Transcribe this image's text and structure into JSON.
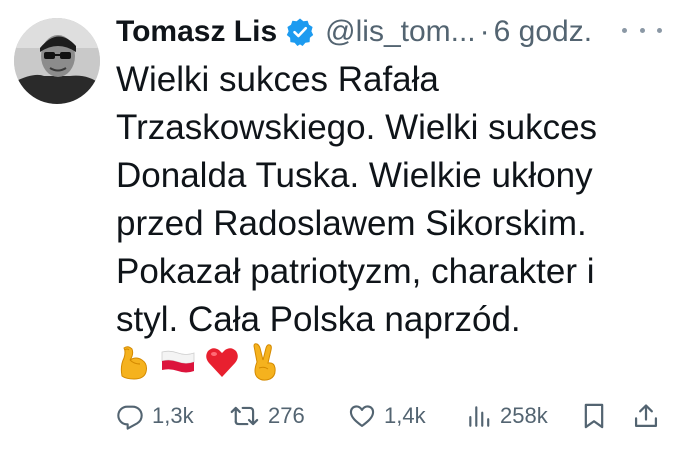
{
  "author": {
    "name": "Tomasz Lis",
    "handle": "@lis_tom...",
    "separator": "·",
    "time": "6 godz.",
    "verified": true
  },
  "tweet": {
    "lines": [
      "Wielki sukces Rafała",
      "Trzaskowskiego. Wielki sukces",
      "Donalda Tuska. Wielkie ukłony",
      "przed Radoslawem Sikorskim.",
      "Pokazał patriotyzm, charakter i",
      "styl. Cała Polska naprzód."
    ],
    "emojis": [
      "flexed-biceps-emoji",
      "poland-flag-emoji",
      "red-heart-emoji",
      "victory-hand-emoji"
    ]
  },
  "actions": {
    "replies": "1,3k",
    "reposts": "276",
    "likes": "1,4k",
    "views": "258k"
  },
  "colors": {
    "text": "#0f1419",
    "secondary": "#536471",
    "verified": "#1d9bf0"
  }
}
